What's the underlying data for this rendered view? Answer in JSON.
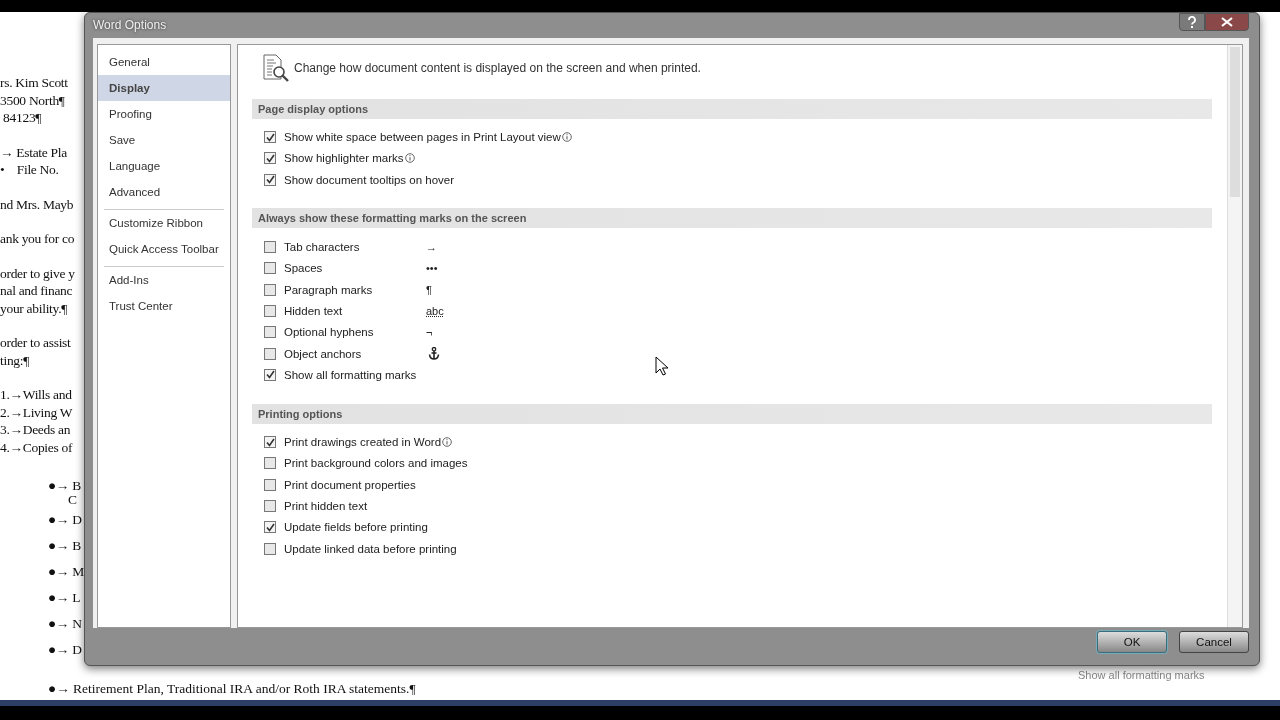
{
  "document": {
    "lines": [
      {
        "kind": "plain",
        "text": "rs. Kim Scott"
      },
      {
        "kind": "plain",
        "text": "3500 North¶"
      },
      {
        "kind": "plain",
        "text": " 84123¶"
      },
      {
        "kind": "gap"
      },
      {
        "kind": "plain",
        "text": "→ Estate Pla"
      },
      {
        "kind": "plain",
        "text": "•    File No."
      },
      {
        "kind": "gap"
      },
      {
        "kind": "plain",
        "text": "nd Mrs. Mayb"
      },
      {
        "kind": "gap"
      },
      {
        "kind": "plain",
        "text": "ank you for co"
      },
      {
        "kind": "gap"
      },
      {
        "kind": "plain",
        "text": "order to give y"
      },
      {
        "kind": "plain",
        "text": "nal and financ"
      },
      {
        "kind": "plain",
        "text": "your ability.¶"
      },
      {
        "kind": "gap"
      },
      {
        "kind": "plain",
        "text": "order to assist"
      },
      {
        "kind": "plain",
        "text": "ting:¶"
      },
      {
        "kind": "gap"
      },
      {
        "kind": "plain",
        "text": "1.→Wills and"
      },
      {
        "kind": "plain",
        "text": "2.→Living W"
      },
      {
        "kind": "plain",
        "text": "3.→Deeds an"
      },
      {
        "kind": "plain",
        "text": "4.→Copies of"
      },
      {
        "kind": "gap"
      },
      {
        "kind": "bullet",
        "text": "●→ B"
      },
      {
        "kind": "indent",
        "text": "C"
      },
      {
        "kind": "bullet",
        "text": "●→ D"
      },
      {
        "kind": "bullet",
        "text": "●→ B"
      },
      {
        "kind": "bullet",
        "text": "●→ M"
      },
      {
        "kind": "bullet",
        "text": "●→ L"
      },
      {
        "kind": "bullet",
        "text": "●→ N"
      },
      {
        "kind": "bullet",
        "text": "●→ D"
      }
    ],
    "last_line": "●→ Retirement Plan, Traditional IRA and/or Roth IRA statements.¶",
    "status_tip": "Show all formatting marks"
  },
  "dialog": {
    "title": "Word Options",
    "nav": [
      [
        {
          "label": "General",
          "selected": false
        },
        {
          "label": "Display",
          "selected": true
        },
        {
          "label": "Proofing",
          "selected": false
        },
        {
          "label": "Save",
          "selected": false
        },
        {
          "label": "Language",
          "selected": false
        },
        {
          "label": "Advanced",
          "selected": false
        }
      ],
      [
        {
          "label": "Customize Ribbon",
          "selected": false
        },
        {
          "label": "Quick Access Toolbar",
          "selected": false
        }
      ],
      [
        {
          "label": "Add-Ins",
          "selected": false
        },
        {
          "label": "Trust Center",
          "selected": false
        }
      ]
    ],
    "intro": "Change how document content is displayed on the screen and when printed.",
    "sections": [
      {
        "title": "Page display options",
        "options": [
          {
            "label": "Show white space between pages in Print Layout view",
            "checked": true,
            "info": true
          },
          {
            "label": "Show highlighter marks",
            "checked": true,
            "info": true
          },
          {
            "label": "Show document tooltips on hover",
            "checked": true,
            "info": false
          }
        ]
      },
      {
        "title": "Always show these formatting marks on the screen",
        "options": [
          {
            "label": "Tab characters",
            "checked": false,
            "info": false,
            "mark": {
              "kind": "text",
              "text": "→"
            }
          },
          {
            "label": "Spaces",
            "checked": false,
            "info": false,
            "mark": {
              "kind": "text",
              "text": "•••"
            }
          },
          {
            "label": "Paragraph marks",
            "checked": false,
            "info": false,
            "mark": {
              "kind": "text",
              "text": "¶"
            }
          },
          {
            "label": "Hidden text",
            "checked": false,
            "info": false,
            "mark": {
              "kind": "hidden",
              "text": "abc"
            }
          },
          {
            "label": "Optional hyphens",
            "checked": false,
            "info": false,
            "mark": {
              "kind": "text",
              "text": "¬"
            }
          },
          {
            "label": "Object anchors",
            "checked": false,
            "info": false,
            "mark": {
              "kind": "anchor"
            }
          },
          {
            "label": "Show all formatting marks",
            "checked": true,
            "info": false
          }
        ]
      },
      {
        "title": "Printing options",
        "options": [
          {
            "label": "Print drawings created in Word",
            "checked": true,
            "info": true
          },
          {
            "label": "Print background colors and images",
            "checked": false,
            "info": false
          },
          {
            "label": "Print document properties",
            "checked": false,
            "info": false
          },
          {
            "label": "Print hidden text",
            "checked": false,
            "info": false
          },
          {
            "label": "Update fields before printing",
            "checked": true,
            "info": false
          },
          {
            "label": "Update linked data before printing",
            "checked": false,
            "info": false
          }
        ]
      }
    ],
    "buttons": [
      {
        "label": "OK",
        "kind": "default"
      },
      {
        "label": "Cancel",
        "kind": "normal"
      }
    ]
  }
}
